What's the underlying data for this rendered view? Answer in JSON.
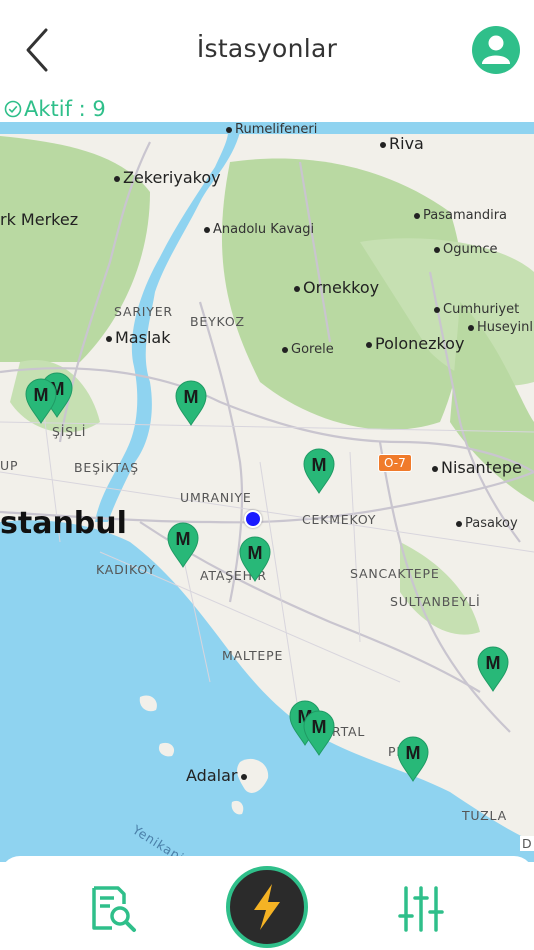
{
  "header": {
    "title": "İstasyonlar"
  },
  "status": {
    "label": "Aktif : 9"
  },
  "map": {
    "places": {
      "rumelifeneri": "Rumelifeneri",
      "riva": "Riva",
      "zekeriyakoy": "Zekeriyakoy",
      "merkez": "rk Merkez",
      "anadolu_kavagi": "Anadolu Kavagi",
      "pasamandira": "Pasamandira",
      "ogumce": "Ogumce",
      "ornekkoy": "Ornekkoy",
      "sariyer": "SARIYER",
      "beykoz": "BEYKOZ",
      "maslak": "Maslak",
      "cumhuriyet": "Cumhuriyet",
      "huseyinli": "Huseyinl",
      "gorele": "Gorele",
      "polonezkoy": "Polonezkoy",
      "sisli": "ŞİŞLİ",
      "besiktas": "BEŞİKTAŞ",
      "up": "UP",
      "nisantepe": "Nisantepe",
      "umraniye": "UMRANIYE",
      "istanbul": "stanbul",
      "cekmekoy": "CEKMEKOY",
      "pasakoy": "Pasakoy",
      "kadikoy": "KADIKOY",
      "atasehir": "ATAŞEHIR",
      "sancaktepe": "SANCAKTEPE",
      "sultanbeyli": "SULTANBEYLİ",
      "maltepe": "MALTEPE",
      "kartal": "RTAL",
      "pendik": "PE  K",
      "adalar": "Adalar",
      "tuzla": "TUZLA",
      "yenikapi": "Yenikapi-Y",
      "edge_d": "D"
    },
    "road_badge": "O-7",
    "marker_letter": "M",
    "colors": {
      "accent": "#2fbf8a",
      "marker": "#28b878",
      "water": "#8fd3f0",
      "forest": "#b9d9a2",
      "land": "#f2f0ea",
      "user_location": "#1a1aff"
    }
  },
  "nav": {
    "search_icon": "station-search-icon",
    "charge_icon": "lightning-icon",
    "filter_icon": "sliders-icon"
  }
}
